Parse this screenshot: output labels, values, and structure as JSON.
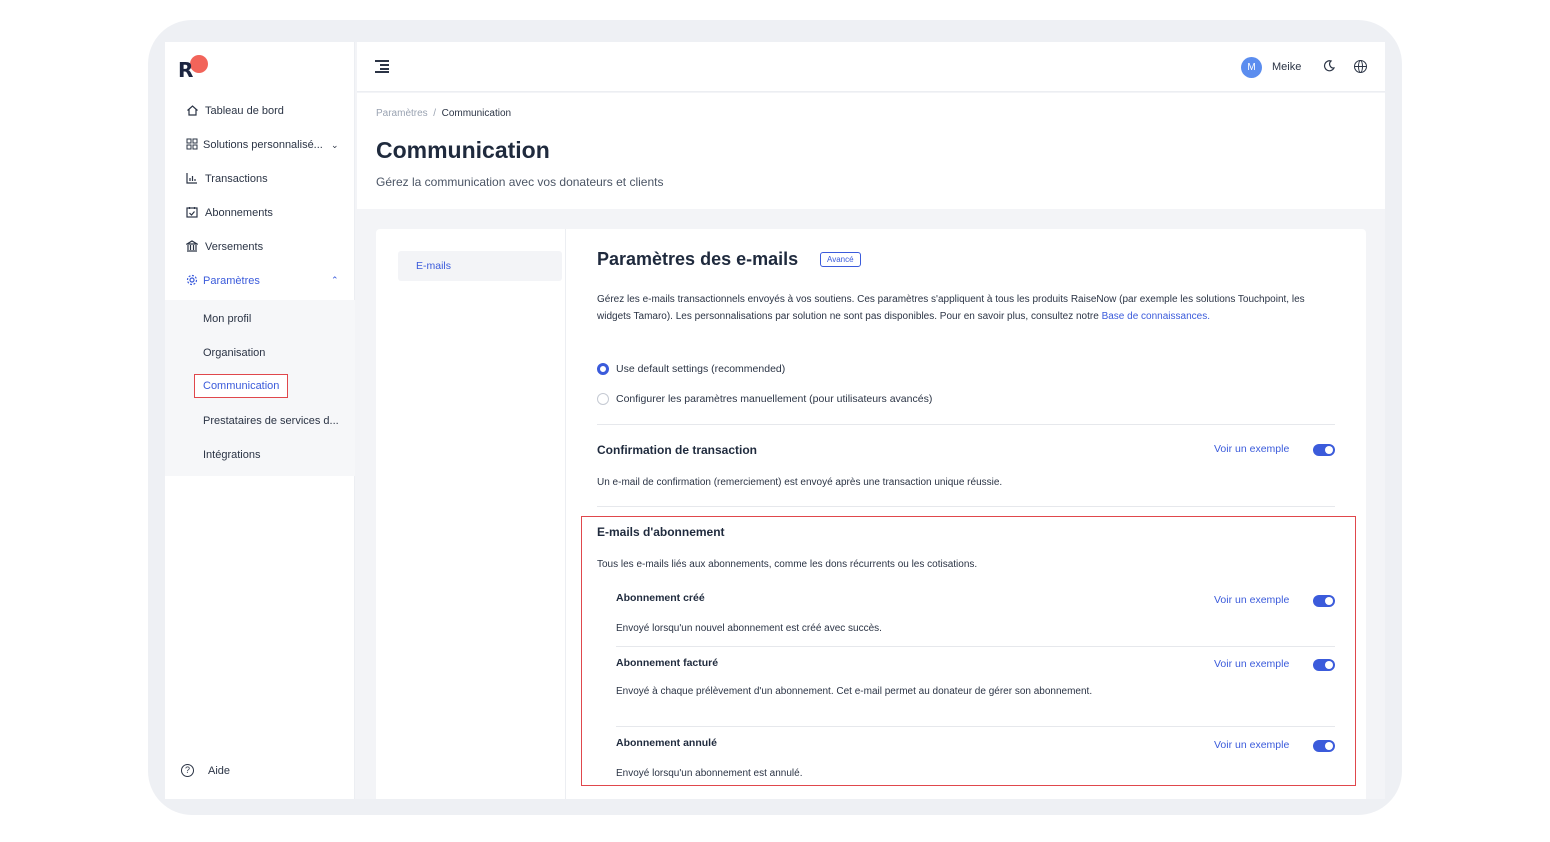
{
  "sidebar": {
    "items": [
      {
        "label": "Tableau de bord",
        "icon": "home-icon"
      },
      {
        "label": "Solutions personnalisé...",
        "icon": "grid-icon"
      },
      {
        "label": "Transactions",
        "icon": "chart-icon"
      },
      {
        "label": "Abonnements",
        "icon": "calendar-check-icon"
      },
      {
        "label": "Versements",
        "icon": "bank-icon"
      },
      {
        "label": "Paramètres",
        "icon": "gear-icon"
      }
    ],
    "sub_items": [
      "Mon profil",
      "Organisation",
      "Communication",
      "Prestataires de services d...",
      "Intégrations"
    ],
    "help": "Aide"
  },
  "topbar": {
    "avatar_initial": "M",
    "user_name": "Meike"
  },
  "header": {
    "breadcrumb_parent": "Paramètres",
    "breadcrumb_sep": "/",
    "breadcrumb_current": "Communication",
    "title": "Communication",
    "subtitle": "Gérez la communication avec vos donateurs et clients"
  },
  "tabs": [
    "E-mails"
  ],
  "email_settings": {
    "title": "Paramètres des e-mails",
    "badge": "Avancé",
    "description": "Gérez les e-mails transactionnels envoyés à vos soutiens. Ces paramètres s'appliquent à tous les produits RaiseNow (par exemple les solutions Touchpoint, les widgets Tamaro). Les personnalisations par solution ne sont pas disponibles. Pour en savoir plus, consultez notre",
    "kb_link": "Base de connaissances",
    "kb_after": ".",
    "radio_default": "Use default settings (recommended)",
    "radio_manual": "Configurer les paramètres manuellement (pour utilisateurs avancés)",
    "see_example": "Voir un exemple"
  },
  "confirmation": {
    "title": "Confirmation de transaction",
    "text": "Un e-mail de confirmation (remerciement) est envoyé après une transaction unique réussie.",
    "enabled": true
  },
  "subscription": {
    "title": "E-mails d'abonnement",
    "text": "Tous les e-mails liés aux abonnements, comme les dons récurrents ou les cotisations.",
    "items": [
      {
        "title": "Abonnement créé",
        "text": "Envoyé lorsqu'un nouvel abonnement est créé avec succès.",
        "enabled": true
      },
      {
        "title": "Abonnement facturé",
        "text": "Envoyé à chaque prélèvement d'un abonnement. Cet e-mail permet au donateur de gérer son abonnement.",
        "enabled": true
      },
      {
        "title": "Abonnement annulé",
        "text": "Envoyé lorsqu'un abonnement est annulé.",
        "enabled": true
      }
    ]
  },
  "colors": {
    "accent": "#3b5bdb",
    "highlight": "#e0474c",
    "logo": "#f2645a"
  }
}
